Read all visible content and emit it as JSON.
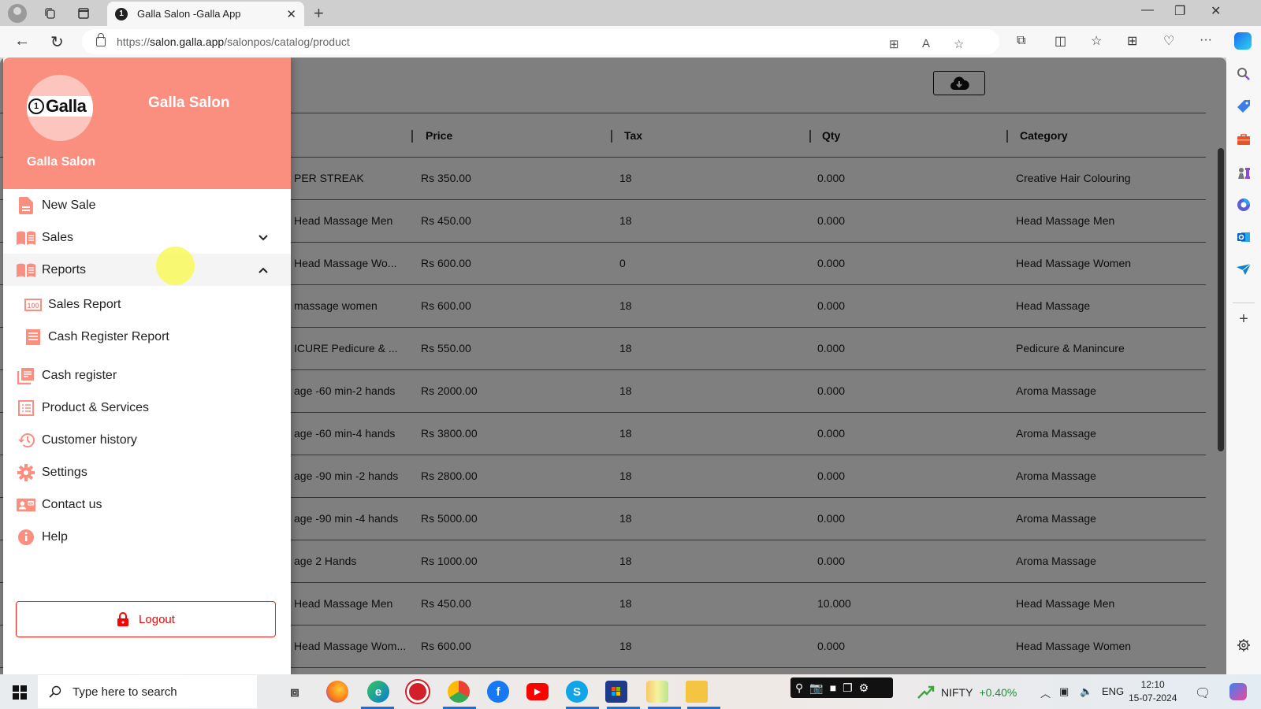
{
  "browser": {
    "tab_title": "Galla Salon -Galla App",
    "url_prefix": "https://",
    "url_domain": "salon.galla.app",
    "url_path": "/salonpos/catalog/product"
  },
  "drawer": {
    "logo_text": "Galla",
    "logo_mark": "1",
    "header_title": "Galla Salon",
    "header_subtitle": "Galla Salon",
    "accent_color": "#fa8e7f",
    "items": [
      {
        "label": "New Sale",
        "icon": "document-icon"
      },
      {
        "label": "Sales",
        "icon": "book-icon",
        "expandable": true,
        "expanded": false
      },
      {
        "label": "Reports",
        "icon": "book-icon",
        "expandable": true,
        "expanded": true
      },
      {
        "label": "Sales Report",
        "icon": "counter-icon",
        "sub": true
      },
      {
        "label": "Cash Register Report",
        "icon": "receipt-icon",
        "sub": true
      },
      {
        "label": "Cash register",
        "icon": "register-icon"
      },
      {
        "label": "Product & Services",
        "icon": "list-icon"
      },
      {
        "label": "Customer history",
        "icon": "history-icon"
      },
      {
        "label": "Settings",
        "icon": "gear-icon"
      },
      {
        "label": "Contact us",
        "icon": "contact-card-icon"
      },
      {
        "label": "Help",
        "icon": "info-icon"
      }
    ],
    "logout_label": "Logout",
    "logout_color": "#ff0000"
  },
  "table": {
    "columns": [
      "Price",
      "Tax",
      "Qty",
      "Category"
    ],
    "rows": [
      {
        "name": "PER STREAK",
        "price": "Rs 350.00",
        "tax": "18",
        "qty": "0.000",
        "category": "Creative Hair Colouring"
      },
      {
        "name": "Head Massage Men",
        "price": "Rs 450.00",
        "tax": "18",
        "qty": "0.000",
        "category": "Head Massage Men"
      },
      {
        "name": "Head Massage Wo...",
        "price": "Rs 600.00",
        "tax": "0",
        "qty": "0.000",
        "category": "Head Massage Women"
      },
      {
        "name": "massage women",
        "price": "Rs 600.00",
        "tax": "18",
        "qty": "0.000",
        "category": "Head Massage"
      },
      {
        "name": "ICURE Pedicure & ...",
        "price": "Rs 550.00",
        "tax": "18",
        "qty": "0.000",
        "category": "Pedicure & Manincure"
      },
      {
        "name": "age -60 min-2 hands",
        "price": "Rs 2000.00",
        "tax": "18",
        "qty": "0.000",
        "category": "Aroma Massage"
      },
      {
        "name": "age -60 min-4 hands",
        "price": "Rs 3800.00",
        "tax": "18",
        "qty": "0.000",
        "category": "Aroma Massage"
      },
      {
        "name": "age -90 min -2 hands",
        "price": "Rs 2800.00",
        "tax": "18",
        "qty": "0.000",
        "category": "Aroma Massage"
      },
      {
        "name": "age -90 min -4 hands",
        "price": "Rs 5000.00",
        "tax": "18",
        "qty": "0.000",
        "category": "Aroma Massage"
      },
      {
        "name": "age 2 Hands",
        "price": "Rs 1000.00",
        "tax": "18",
        "qty": "0.000",
        "category": "Aroma Massage"
      },
      {
        "name": "Head Massage Men",
        "price": "Rs 450.00",
        "tax": "18",
        "qty": "10.000",
        "category": "Head Massage Men"
      },
      {
        "name": "Head Massage Wom...",
        "price": "Rs 600.00",
        "tax": "18",
        "qty": "0.000",
        "category": "Head Massage Women"
      }
    ]
  },
  "taskbar": {
    "search_placeholder": "Type here to search",
    "nifty_label": "NIFTY",
    "nifty_change": "+0.40%",
    "language": "ENG",
    "time": "12:10",
    "date": "15-07-2024"
  }
}
